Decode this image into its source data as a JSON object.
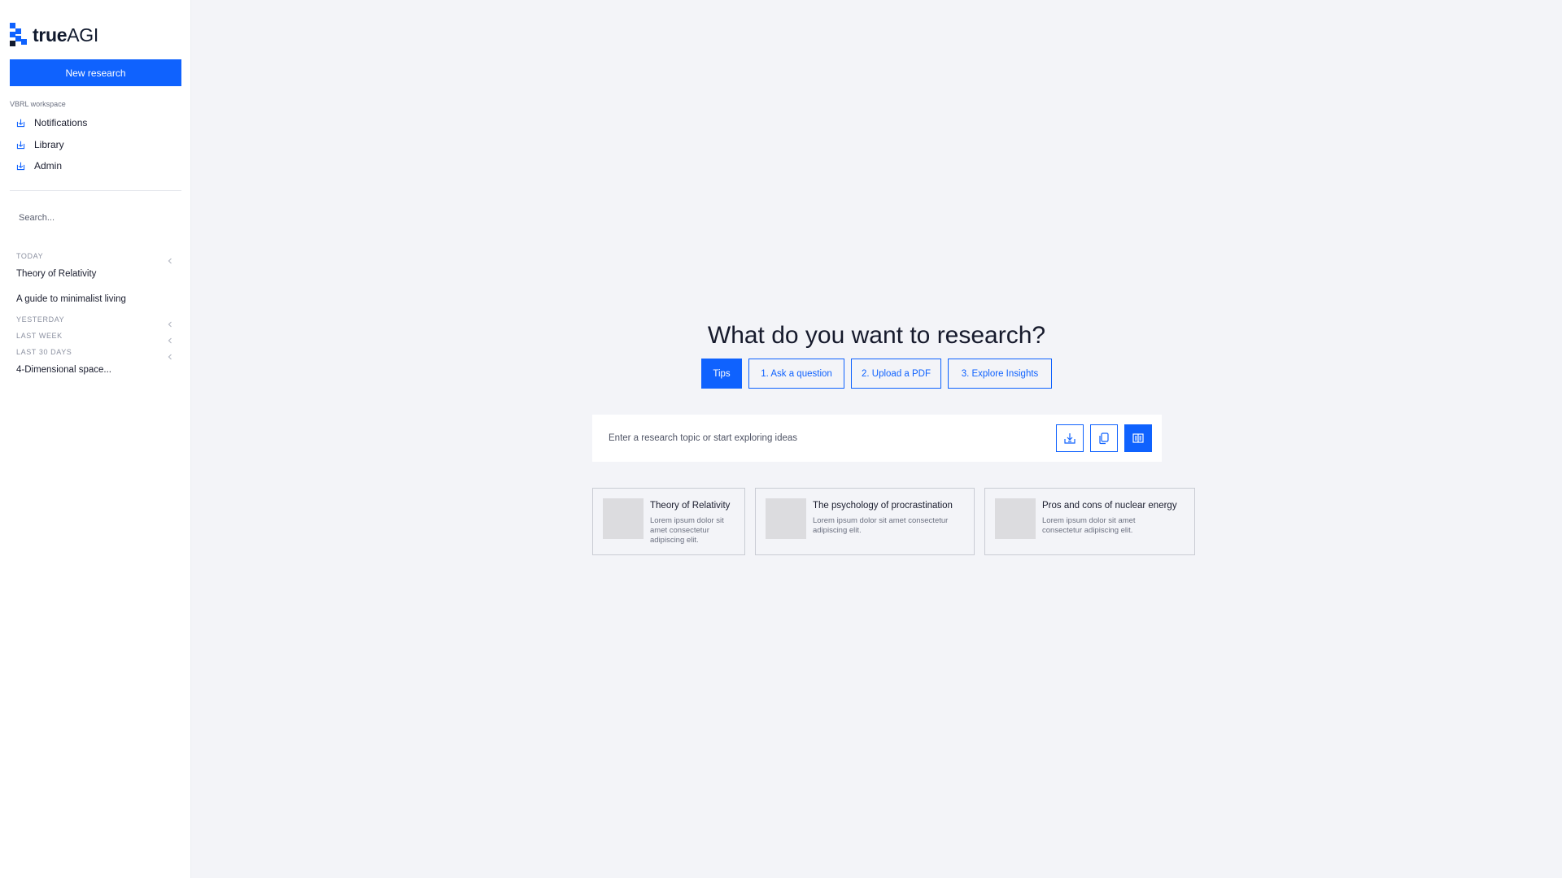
{
  "brand": {
    "name_bold": "true",
    "name_light": "AGI",
    "accent": "#0f62fe"
  },
  "sidebar": {
    "new_research_label": "New research",
    "workspace_label": "VBRL workspace",
    "nav": [
      {
        "label": "Notifications",
        "icon": "download-icon"
      },
      {
        "label": "Library",
        "icon": "download-icon"
      },
      {
        "label": "Admin",
        "icon": "download-icon"
      }
    ],
    "search_placeholder": "Search...",
    "history": {
      "today_label": "TODAY",
      "today_items": [
        "Theory of Relativity",
        "A guide to minimalist living"
      ],
      "yesterday_label": "YESTERDAY",
      "last_week_label": "LAST WEEK",
      "last_30_label": "LAST 30 DAYS",
      "last_30_items": [
        "4-Dimensional space..."
      ]
    }
  },
  "main": {
    "headline": "What do you want to research?",
    "tabs": [
      {
        "label": "Tips",
        "active": true
      },
      {
        "label": "1. Ask a question",
        "active": false
      },
      {
        "label": "2. Upload a PDF",
        "active": false
      },
      {
        "label": "3. Explore Insights",
        "active": false
      }
    ],
    "input_placeholder": "Enter a research topic or start exploring ideas",
    "actions": [
      {
        "icon": "import-icon"
      },
      {
        "icon": "copy-icon"
      },
      {
        "icon": "document-icon"
      }
    ],
    "suggestions": [
      {
        "title": "Theory of Relativity",
        "desc": "Lorem ipsum dolor sit amet consectetur adipiscing elit."
      },
      {
        "title": "The psychology of procrastination",
        "desc": "Lorem ipsum dolor sit amet consectetur adipiscing elit."
      },
      {
        "title": "Pros and cons of nuclear energy",
        "desc": "Lorem ipsum dolor sit amet consectetur adipiscing elit."
      }
    ]
  }
}
